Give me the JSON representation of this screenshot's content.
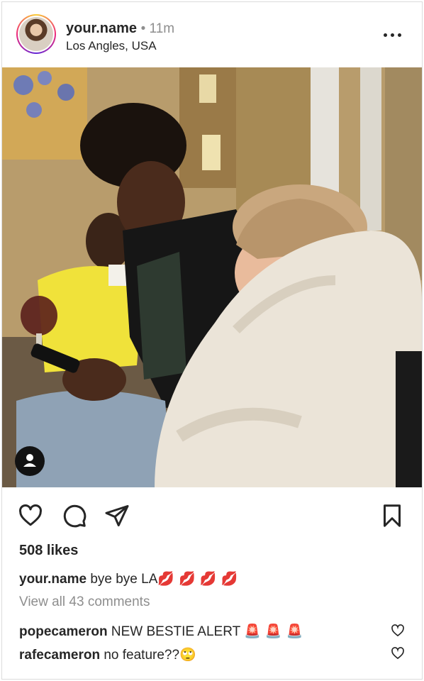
{
  "header": {
    "username": "your.name",
    "time": "11m",
    "location": "Los Angles, USA",
    "more_icon": "more-horizontal-icon"
  },
  "post": {
    "photo_description_icon": "user-tag-icon"
  },
  "actions": {
    "like_icon": "heart-outline-icon",
    "comment_icon": "comment-bubble-icon",
    "share_icon": "paper-plane-icon",
    "save_icon": "bookmark-outline-icon"
  },
  "likes": "508 likes",
  "caption": {
    "username": "your.name",
    "text": "bye bye LA",
    "emoji": "💋 💋 💋 💋"
  },
  "view_all_comments": "View all 43 comments",
  "comments": [
    {
      "username": "popecameron",
      "text": "NEW BESTIE ALERT",
      "emoji": "🚨 🚨 🚨"
    },
    {
      "username": "rafecameron",
      "text": "no feature??",
      "emoji": "🙄"
    }
  ],
  "colors": {
    "text": "#262626",
    "secondary": "#8e8e8e",
    "border": "#dbdbdb",
    "story_ring_start": "#f9ce34",
    "story_ring_mid": "#ee2a7b",
    "story_ring_end": "#6228d7"
  }
}
